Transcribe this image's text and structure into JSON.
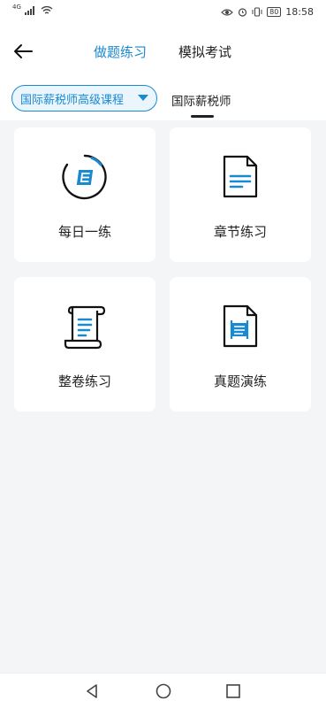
{
  "status_bar": {
    "network": "4G",
    "battery": "80",
    "time": "18:58"
  },
  "header": {
    "tabs": [
      {
        "label": "做题练习",
        "active": true
      },
      {
        "label": "模拟考试",
        "active": false
      }
    ]
  },
  "subheader": {
    "course_select": "国际薪税师高级课程",
    "sub_tab": "国际薪税师"
  },
  "cards": [
    {
      "label": "每日一练",
      "icon": "calendar-day-icon"
    },
    {
      "label": "章节练习",
      "icon": "document-icon"
    },
    {
      "label": "整卷练习",
      "icon": "scroll-icon"
    },
    {
      "label": "真题演练",
      "icon": "exam-paper-icon"
    }
  ],
  "colors": {
    "accent": "#1a8ad0",
    "background": "#f4f5f7",
    "card": "#ffffff"
  }
}
